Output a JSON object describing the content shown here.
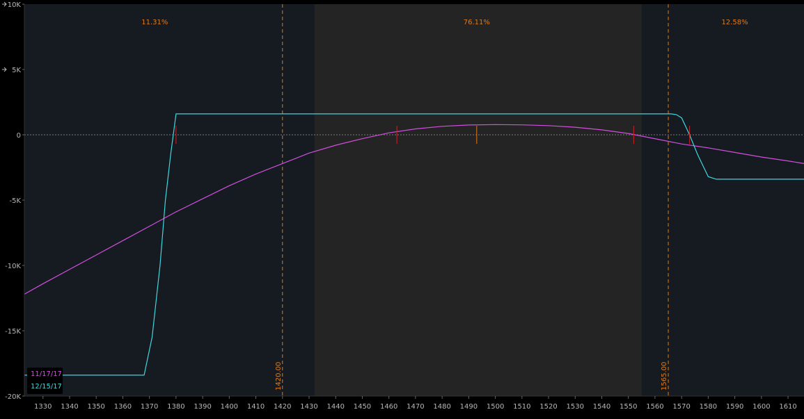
{
  "chart_data": {
    "type": "line",
    "xlim": [
      1323,
      1616
    ],
    "ylim": [
      -20000,
      10000
    ],
    "x_ticks": [
      1330,
      1340,
      1350,
      1360,
      1370,
      1380,
      1390,
      1400,
      1410,
      1420,
      1430,
      1440,
      1450,
      1460,
      1470,
      1480,
      1490,
      1500,
      1510,
      1520,
      1530,
      1540,
      1550,
      1560,
      1570,
      1580,
      1590,
      1600,
      1610
    ],
    "y_ticks": [
      {
        "value": 10000,
        "label": "10K"
      },
      {
        "value": 5000,
        "label": "5K"
      },
      {
        "value": 0,
        "label": "0"
      },
      {
        "value": -5000,
        "label": "-5K"
      },
      {
        "value": -10000,
        "label": "-10K"
      },
      {
        "value": -15000,
        "label": "-15K"
      },
      {
        "value": -20000,
        "label": "-20K"
      }
    ],
    "y_markers": [
      10000,
      5000
    ],
    "zero_line": 0,
    "shaded_range": [
      1432,
      1555
    ],
    "vertical_lines": [
      {
        "x": 1420,
        "label": "1420.00"
      },
      {
        "x": 1565,
        "label": "1565.00"
      }
    ],
    "zone_labels": [
      {
        "x": 1372,
        "label": "11.31%"
      },
      {
        "x": 1493,
        "label": "76.11%"
      },
      {
        "x": 1590,
        "label": "12.58%"
      }
    ],
    "tick_marks": [
      {
        "x": 1380,
        "y": 0,
        "color": "#d0202a"
      },
      {
        "x": 1463,
        "y": 0,
        "color": "#d0202a"
      },
      {
        "x": 1493,
        "y": 0,
        "color": "#e07a1a"
      },
      {
        "x": 1552,
        "y": 0,
        "color": "#d0202a"
      },
      {
        "x": 1573,
        "y": 0,
        "color": "#d0202a"
      }
    ],
    "series": [
      {
        "name": "11/17/17",
        "color": "#d24fe0",
        "points": [
          [
            1323,
            -12200
          ],
          [
            1330,
            -11400
          ],
          [
            1340,
            -10300
          ],
          [
            1350,
            -9200
          ],
          [
            1360,
            -8100
          ],
          [
            1370,
            -7000
          ],
          [
            1380,
            -5900
          ],
          [
            1390,
            -4900
          ],
          [
            1400,
            -3900
          ],
          [
            1410,
            -3000
          ],
          [
            1420,
            -2200
          ],
          [
            1430,
            -1400
          ],
          [
            1440,
            -800
          ],
          [
            1450,
            -300
          ],
          [
            1460,
            150
          ],
          [
            1470,
            450
          ],
          [
            1480,
            650
          ],
          [
            1490,
            750
          ],
          [
            1500,
            780
          ],
          [
            1510,
            760
          ],
          [
            1520,
            700
          ],
          [
            1530,
            580
          ],
          [
            1540,
            380
          ],
          [
            1550,
            100
          ],
          [
            1560,
            -300
          ],
          [
            1570,
            -700
          ],
          [
            1580,
            -1000
          ],
          [
            1590,
            -1350
          ],
          [
            1600,
            -1700
          ],
          [
            1610,
            -2000
          ],
          [
            1616,
            -2200
          ]
        ]
      },
      {
        "name": "12/15/17",
        "color": "#3fd7e0",
        "points": [
          [
            1323,
            -18400
          ],
          [
            1368,
            -18400
          ],
          [
            1371,
            -15500
          ],
          [
            1374,
            -10000
          ],
          [
            1376,
            -5000
          ],
          [
            1378,
            -1500
          ],
          [
            1380,
            1600
          ],
          [
            1430,
            1600
          ],
          [
            1500,
            1600
          ],
          [
            1566,
            1600
          ],
          [
            1568,
            1550
          ],
          [
            1570,
            1300
          ],
          [
            1573,
            0
          ],
          [
            1576,
            -1500
          ],
          [
            1580,
            -3200
          ],
          [
            1583,
            -3400
          ],
          [
            1616,
            -3400
          ]
        ]
      }
    ]
  },
  "legend": {
    "item1": {
      "label": "11/17/17",
      "color": "#d24fe0"
    },
    "item2": {
      "label": "12/15/17",
      "color": "#3fd7e0"
    }
  },
  "colors": {
    "background": "#161b21",
    "shaded": "#242424",
    "axis_text": "#b8b8b8",
    "orange": "#e07a1a"
  }
}
